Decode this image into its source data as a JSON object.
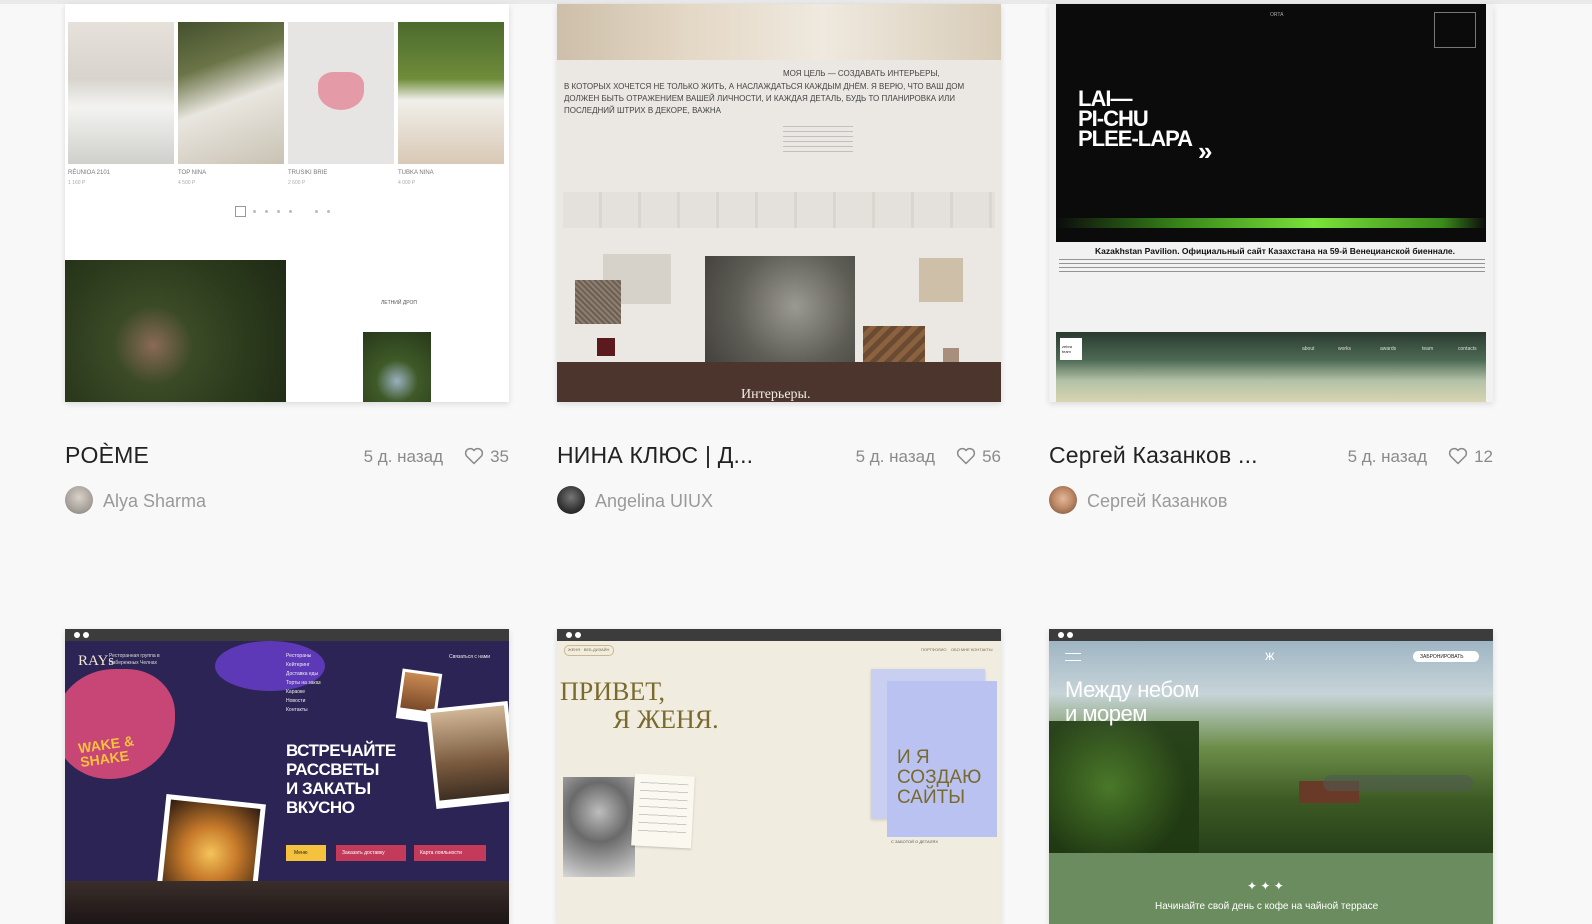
{
  "cards": [
    {
      "title": "POÈME",
      "time": "5 д. назад",
      "likes": "35",
      "author": "Alya Sharma",
      "thumb": {
        "products": [
          "RÉUNIOA 2101",
          "TOP NINA",
          "TRUSIKI BRIE",
          "TUBKA NINA"
        ],
        "prices": [
          "1 160 Р",
          "4 500 Р",
          "2 600 Р",
          "4 000 Р"
        ],
        "caption": "ЛЕТНИЙ ДРОП"
      }
    },
    {
      "title": "НИНА КЛЮС | Д...",
      "time": "5 д. назад",
      "likes": "56",
      "author": "Angelina UIUX",
      "thumb": {
        "headline_1": "МОЯ ЦЕЛЬ — СОЗДАВАТЬ ИНТЕРЬЕРЫ,",
        "headline_2": "В КОТОРЫХ ХОЧЕТСЯ НЕ ТОЛЬКО ЖИТЬ, А НАСЛАЖДАТЬСЯ КАЖДЫМ ДНЁМ. Я ВЕРЮ, ЧТО ВАШ ДОМ",
        "headline_3": "ДОЛЖЕН БЫТЬ ОТРАЖЕНИЕМ ВАШЕЙ ЛИЧНОСТИ, И КАЖДАЯ ДЕТАЛЬ, БУДЬ ТО ПЛАНИРОВКА ИЛИ",
        "headline_4": "ПОСЛЕДНИЙ ШТРИХ В ДЕКОРЕ, ВАЖНА",
        "footer": "Интерьеры."
      }
    },
    {
      "title": "Сергей Казанков ...",
      "time": "5 д. назад",
      "likes": "12",
      "author": "Сергей Казанков",
      "thumb": {
        "brand": "ORTA",
        "logo_line_1": "LAI—",
        "logo_line_2": "PI-CHU",
        "logo_line_3": "PLEE-LAPA",
        "caption": "Kazakhstan Pavilion. Официальный сайт Казахстана на 59-й Венецианской биеннале.",
        "nav": [
          "about",
          "works",
          "awards",
          "team",
          "contacts"
        ],
        "badge": "zebra team"
      }
    },
    {
      "title": "",
      "time": "",
      "likes": "",
      "author": "",
      "thumb": {
        "logo": "RAYs",
        "tagline": "Ресторанная группа в Набережных Челнах",
        "menu": [
          "Рестораны",
          "Кейтеринг",
          "Доставка еды",
          "Торты на заказ",
          "Караоке",
          "Новости",
          "Контакты"
        ],
        "contact": "Связаться с нами",
        "headline": [
          "ВСТРЕЧАЙТЕ",
          "РАССВЕТЫ",
          "И ЗАКАТЫ",
          "ВКУСНО"
        ],
        "sticker": "WAKE & SHAKE",
        "buttons": [
          "Меню",
          "Заказать доставку",
          "Карта лояльности"
        ]
      }
    },
    {
      "title": "",
      "time": "",
      "likes": "",
      "author": "",
      "thumb": {
        "tag": "ЖЕНЯ · ВЕБ-ДИЗАЙН",
        "nav": [
          "ПОРТФОЛИО",
          "ОБО МНЕ",
          "КОНТАКТЫ"
        ],
        "greeting_1": "ПРИВЕТ,",
        "greeting_2": "Я ЖЕНЯ.",
        "note": [
          "И Я",
          "СОЗДАЮ",
          "САЙТЫ"
        ],
        "sub": "С ЗАБОТОЙ О ДЕТАЛЯХ"
      }
    },
    {
      "title": "",
      "time": "",
      "likes": "",
      "author": "",
      "thumb": {
        "headline_1": "Между небом",
        "headline_2": "и морем",
        "book": "ЗАБРОНИРОВАТЬ",
        "footer": "Начинайте свой день с кофе на чайной террасе"
      }
    }
  ],
  "colors": {
    "background": "#f8f8f8",
    "title": "#222222",
    "muted": "#8a8a8a",
    "author": "#9a9a9a"
  }
}
